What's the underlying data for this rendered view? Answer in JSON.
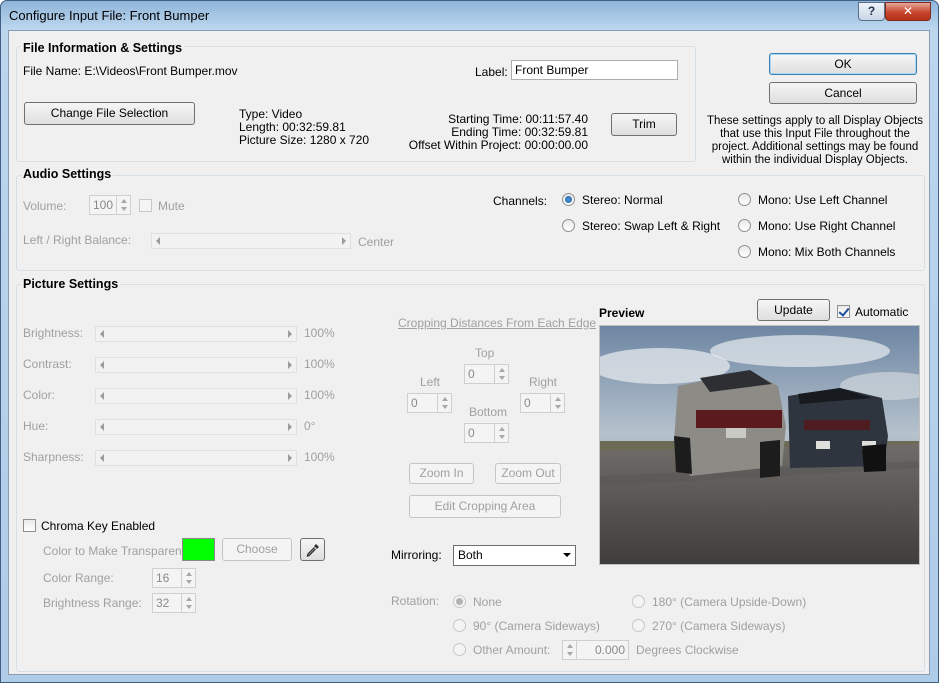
{
  "window": {
    "title": "Configure Input File: Front Bumper",
    "help_label": "?",
    "close_label": "✕"
  },
  "file_info": {
    "group_title": "File Information & Settings",
    "file_name": "File Name:  E:\\Videos\\Front Bumper.mov",
    "label_caption": "Label:",
    "label_value": "Front Bumper",
    "change_button": "Change File Selection",
    "type": "Type: Video",
    "length": "Length: 00:32:59.81",
    "picture_size": "Picture Size: 1280 x 720",
    "starting_time": "Starting Time: 00:11:57.40",
    "ending_time": "Ending Time: 00:32:59.81",
    "offset": "Offset Within Project: 00:00:00.00",
    "trim_button": "Trim"
  },
  "dialog_buttons": {
    "ok": "OK",
    "cancel": "Cancel",
    "note_lines": [
      "These settings apply to all Display Objects",
      "that use this Input File throughout the",
      "project. Additional settings may be found",
      "within the individual Display Objects."
    ]
  },
  "audio": {
    "group_title": "Audio Settings",
    "volume_label": "Volume:",
    "volume_value": "100",
    "mute_label": "Mute",
    "balance_label": "Left / Right Balance:",
    "balance_value": "Center",
    "balance_position": 0.5,
    "channels_label": "Channels:",
    "channel_options": [
      {
        "label": "Stereo: Normal",
        "selected": true
      },
      {
        "label": "Stereo: Swap Left & Right",
        "selected": false
      },
      {
        "label": "Mono: Use Left Channel",
        "selected": false
      },
      {
        "label": "Mono: Use Right Channel",
        "selected": false
      },
      {
        "label": "Mono: Mix Both Channels",
        "selected": false
      }
    ]
  },
  "picture": {
    "group_title": "Picture Settings",
    "adjustments": [
      {
        "label": "Brightness:",
        "value": "100%"
      },
      {
        "label": "Contrast:",
        "value": "100%"
      },
      {
        "label": "Color:",
        "value": "100%"
      },
      {
        "label": "Hue:",
        "value": "0°"
      },
      {
        "label": "Sharpness:",
        "value": "100%"
      }
    ],
    "cropping": {
      "title": "Cropping Distances From Each Edge",
      "top_label": "Top",
      "left_label": "Left",
      "right_label": "Right",
      "bottom_label": "Bottom",
      "top": "0",
      "left": "0",
      "right": "0",
      "bottom": "0",
      "zoom_in": "Zoom In",
      "zoom_out": "Zoom Out",
      "edit_area": "Edit Cropping Area"
    },
    "chroma": {
      "enabled_label": "Chroma Key Enabled",
      "color_label": "Color to Make Transparent:",
      "color": "#00ff00",
      "choose_button": "Choose",
      "range_label": "Color Range:",
      "range_value": "16",
      "brightness_range_label": "Brightness Range:",
      "brightness_range_value": "32"
    },
    "mirroring_label": "Mirroring:",
    "mirroring_value": "Both",
    "rotation": {
      "label": "Rotation:",
      "none": "None",
      "deg90": "90° (Camera Sideways)",
      "other": "Other Amount:",
      "other_value": "0.000",
      "degrees_label": "Degrees Clockwise",
      "deg180": "180° (Camera Upside-Down)",
      "deg270": "270° (Camera Sideways)"
    },
    "preview": {
      "title": "Preview",
      "update_button": "Update",
      "automatic_label": "Automatic",
      "automatic_checked": true
    }
  }
}
